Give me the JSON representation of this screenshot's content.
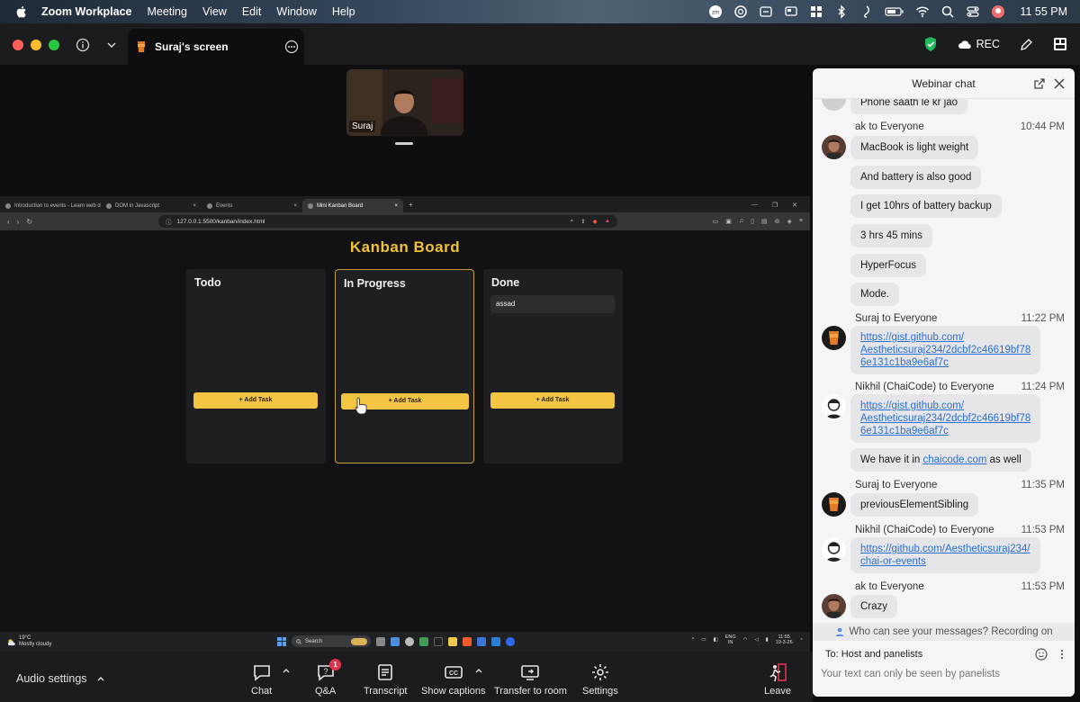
{
  "menubar": {
    "app_name": "Zoom Workplace",
    "items": [
      "Meeting",
      "View",
      "Edit",
      "Window",
      "Help"
    ],
    "clock": "11 55 PM"
  },
  "zoombar": {
    "tab_title": "Suraj's screen",
    "rec_label": "REC",
    "shield_color": "#1fb85c"
  },
  "participant": {
    "name": "Suraj"
  },
  "browser": {
    "tabs": [
      "Introduction to events - Learn web d",
      "DOM in Javascript",
      "Events",
      "Mini Kanban Board"
    ],
    "new_tab": "+",
    "url": "127.0.0.1:5500/kanban/index.html"
  },
  "kanban": {
    "title": "Kanban Board",
    "columns": [
      {
        "name": "Todo",
        "tasks": [],
        "add_label": "+ Add Task"
      },
      {
        "name": "In Progress",
        "tasks": [],
        "add_label": "+ Add Task"
      },
      {
        "name": "Done",
        "tasks": [
          "assad"
        ],
        "add_label": "+ Add Task"
      }
    ],
    "accent": "#f1c232"
  },
  "taskbar": {
    "weather_temp": "19°C",
    "weather_text": "Mostly cloudy",
    "search_placeholder": "Search",
    "lang_top": "ENG",
    "lang_bottom": "IN",
    "time": "11:55",
    "date": "19-3-26"
  },
  "controls": {
    "audio_settings": "Audio settings",
    "buttons": [
      "Chat",
      "Q&A",
      "Transcript",
      "Show captions",
      "Transfer to room",
      "Settings"
    ],
    "qa_badge": "1",
    "leave": "Leave"
  },
  "chat": {
    "title": "Webinar chat",
    "messages": [
      {
        "text": "Phone saath le kr jao"
      },
      {
        "name": "ak to Everyone",
        "time": "10:44 PM"
      },
      {
        "text": "MacBook is light weight"
      },
      {
        "text": "And battery is also good"
      },
      {
        "text": "I get 10hrs of battery backup"
      },
      {
        "text": "3 hrs 45 mins"
      },
      {
        "text": "HyperFocus"
      },
      {
        "text": "Mode."
      },
      {
        "name": "Suraj to Everyone",
        "time": "11:22 PM"
      },
      {
        "link_lines": [
          "https://gist.github.com/",
          "Aestheticsuraj234/2dcbf2c46619bf78",
          "6e131c1ba9e6af7c"
        ]
      },
      {
        "name": "Nikhil (ChaiCode) to Everyone",
        "time": "11:24 PM"
      },
      {
        "link_lines": [
          "https://gist.github.com/",
          "Aestheticsuraj234/2dcbf2c46619bf78",
          "6e131c1ba9e6af7c"
        ]
      },
      {
        "text_before": "We have it in ",
        "link": "chaicode.com",
        "text_after": " as well"
      },
      {
        "name": "Suraj to Everyone",
        "time": "11:35 PM"
      },
      {
        "text": "previousElementSibling"
      },
      {
        "name": "Nikhil (ChaiCode) to Everyone",
        "time": "11:53 PM"
      },
      {
        "link_lines": [
          "https://github.com/Aestheticsuraj234/",
          "chai-or-events"
        ]
      },
      {
        "name": "ak to Everyone",
        "time": "11:53 PM"
      },
      {
        "text": "Crazy"
      }
    ],
    "privacy": "Who can see your messages? Recording on",
    "to": "To: Host and panelists",
    "input_placeholder": "Your text can only be seen by panelists"
  }
}
